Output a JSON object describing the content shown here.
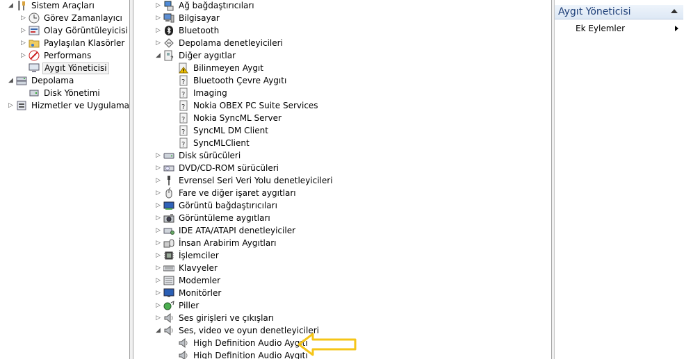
{
  "left_tree": {
    "items": [
      {
        "label": "Sistem Araçları",
        "icon": "tools-icon",
        "expander": "expanded"
      },
      {
        "label": "Görev Zamanlayıcı",
        "icon": "clock-icon",
        "expander": "collapsed"
      },
      {
        "label": "Olay Görüntüleyicisi",
        "icon": "event-viewer-icon",
        "expander": "collapsed"
      },
      {
        "label": "Paylaşılan Klasörler",
        "icon": "shared-folder-icon",
        "expander": "collapsed"
      },
      {
        "label": "Performans",
        "icon": "performance-icon",
        "expander": "collapsed"
      },
      {
        "label": "Aygıt Yöneticisi",
        "icon": "device-manager-icon",
        "expander": "none",
        "selected": true
      },
      {
        "label": "Depolama",
        "icon": "storage-icon",
        "expander": "expanded"
      },
      {
        "label": "Disk Yönetimi",
        "icon": "disk-management-icon",
        "expander": "none"
      },
      {
        "label": "Hizmetler ve Uygulamalar",
        "icon": "services-icon",
        "expander": "collapsed"
      }
    ]
  },
  "device_tree": {
    "items": [
      {
        "label": "Ağ bağdaştırıcıları",
        "icon": "network-adapter-icon",
        "expander": "collapsed"
      },
      {
        "label": "Bilgisayar",
        "icon": "computer-icon",
        "expander": "collapsed"
      },
      {
        "label": "Bluetooth",
        "icon": "bluetooth-icon",
        "expander": "collapsed"
      },
      {
        "label": "Depolama denetleyicileri",
        "icon": "storage-controller-icon",
        "expander": "collapsed"
      },
      {
        "label": "Diğer aygıtlar",
        "icon": "other-devices-icon",
        "expander": "expanded"
      },
      {
        "label": "Bilinmeyen Aygıt",
        "icon": "unknown-device-warning-icon",
        "expander": "none",
        "child": true
      },
      {
        "label": "Bluetooth Çevre Aygıtı",
        "icon": "unknown-device-icon",
        "expander": "none",
        "child": true
      },
      {
        "label": "Imaging",
        "icon": "unknown-device-icon",
        "expander": "none",
        "child": true
      },
      {
        "label": "Nokia OBEX PC Suite Services",
        "icon": "unknown-device-icon",
        "expander": "none",
        "child": true
      },
      {
        "label": "Nokia SyncML Server",
        "icon": "unknown-device-icon",
        "expander": "none",
        "child": true
      },
      {
        "label": "SyncML DM Client",
        "icon": "unknown-device-icon",
        "expander": "none",
        "child": true
      },
      {
        "label": "SyncMLClient",
        "icon": "unknown-device-icon",
        "expander": "none",
        "child": true
      },
      {
        "label": "Disk sürücüleri",
        "icon": "disk-drive-icon",
        "expander": "collapsed"
      },
      {
        "label": "DVD/CD-ROM sürücüleri",
        "icon": "dvd-drive-icon",
        "expander": "collapsed"
      },
      {
        "label": "Evrensel Seri Veri Yolu denetleyicileri",
        "icon": "usb-icon",
        "expander": "collapsed"
      },
      {
        "label": "Fare ve diğer işaret aygıtları",
        "icon": "mouse-icon",
        "expander": "collapsed"
      },
      {
        "label": "Görüntü bağdaştırıcıları",
        "icon": "display-adapter-icon",
        "expander": "collapsed"
      },
      {
        "label": "Görüntüleme aygıtları",
        "icon": "imaging-device-icon",
        "expander": "collapsed"
      },
      {
        "label": "IDE ATA/ATAPI denetleyiciler",
        "icon": "ide-controller-icon",
        "expander": "collapsed"
      },
      {
        "label": "İnsan Arabirim Aygıtları",
        "icon": "hid-icon",
        "expander": "collapsed"
      },
      {
        "label": "İşlemciler",
        "icon": "processor-icon",
        "expander": "collapsed"
      },
      {
        "label": "Klavyeler",
        "icon": "keyboard-icon",
        "expander": "collapsed"
      },
      {
        "label": "Modemler",
        "icon": "modem-icon",
        "expander": "collapsed"
      },
      {
        "label": "Monitörler",
        "icon": "monitor-icon",
        "expander": "collapsed"
      },
      {
        "label": "Piller",
        "icon": "battery-icon",
        "expander": "collapsed"
      },
      {
        "label": "Ses girişleri ve çıkışları",
        "icon": "speaker-icon",
        "expander": "collapsed"
      },
      {
        "label": "Ses, video ve oyun denetleyicileri",
        "icon": "speaker-icon",
        "expander": "expanded"
      },
      {
        "label": "High Definition Audio Aygıtı",
        "icon": "speaker-icon",
        "expander": "none",
        "child": true
      },
      {
        "label": "High Definition Audio Aygıtı",
        "icon": "speaker-icon",
        "expander": "none",
        "child": true
      }
    ]
  },
  "actions": {
    "header": "Aygıt Yöneticisi",
    "more_actions": "Ek Eylemler"
  },
  "colors": {
    "annotation_arrow": "#f5c518",
    "action_header_text": "#1e3f78",
    "warning": "#f2c200"
  }
}
